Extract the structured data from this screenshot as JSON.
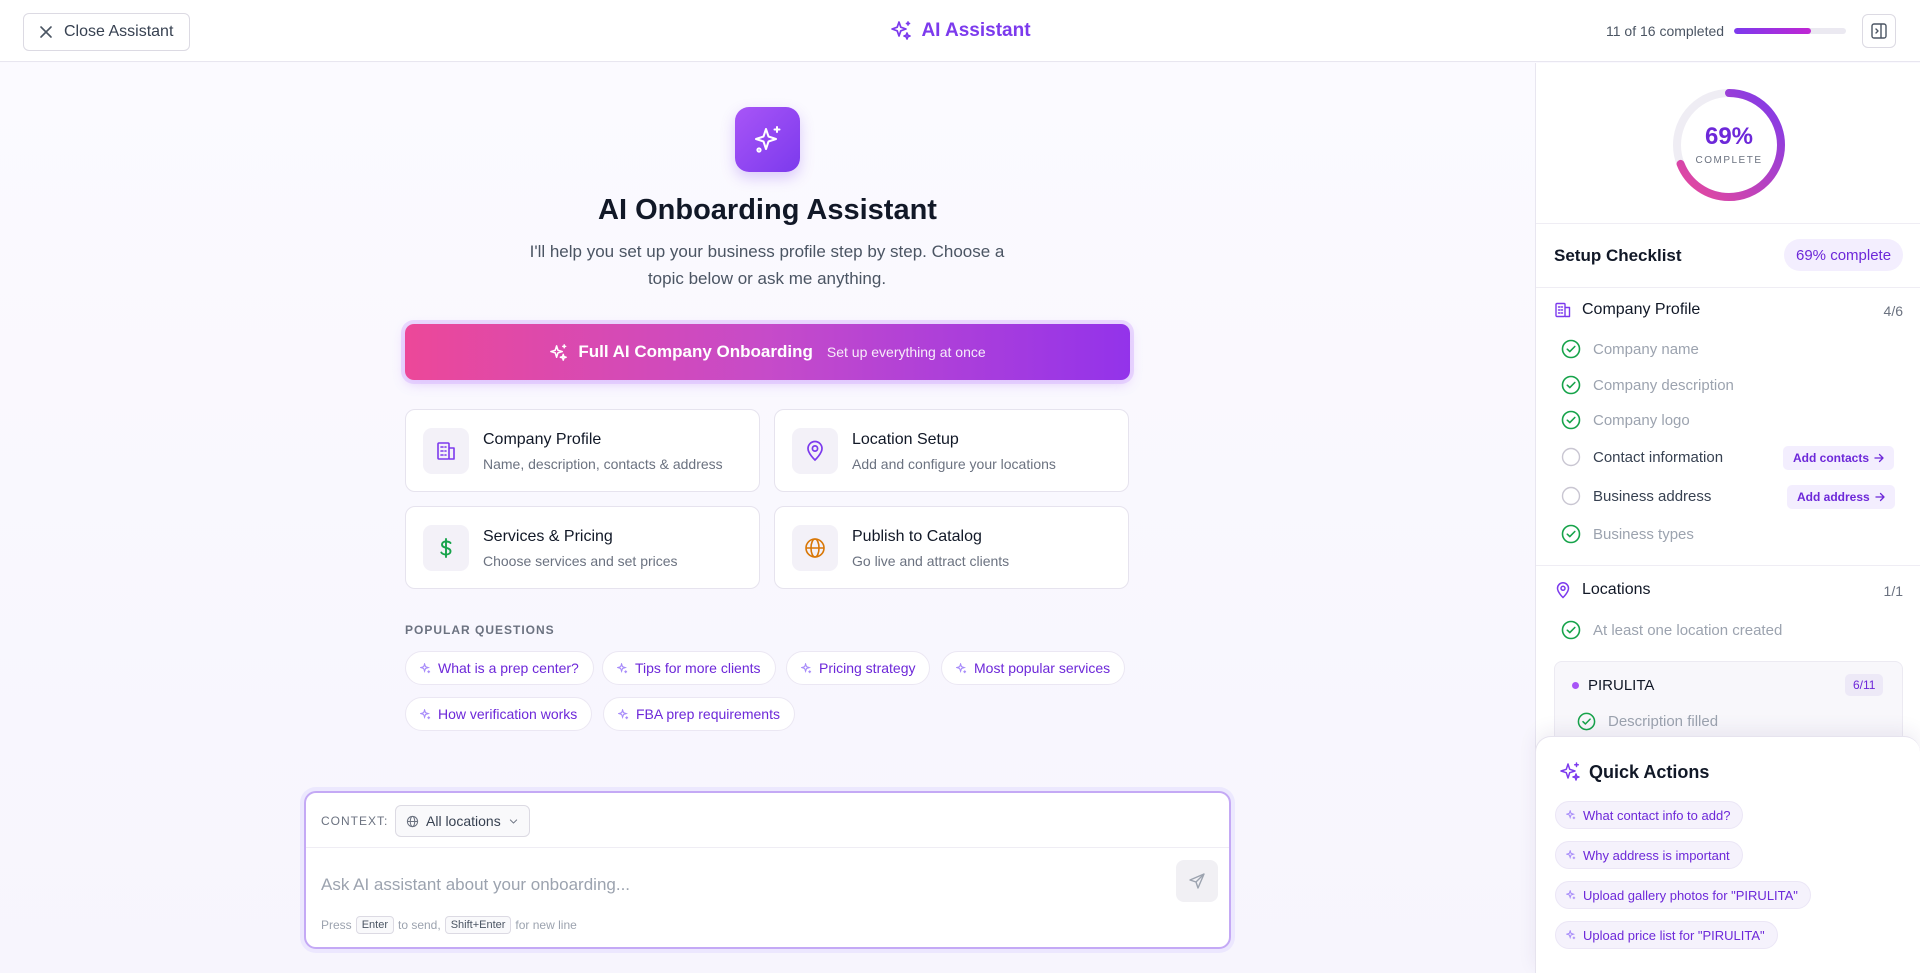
{
  "header": {
    "close_label": "Close Assistant",
    "title": "AI Assistant",
    "progress_text": "11 of 16 completed",
    "progress_fraction": 0.69
  },
  "hero": {
    "title": "AI Onboarding Assistant",
    "subtitle": "I'll help you set up your business profile step by step. Choose a topic below or ask me anything."
  },
  "full_onboarding": {
    "title": "Full AI Company Onboarding",
    "subtitle": "Set up everything at once"
  },
  "topics": [
    {
      "title": "Company Profile",
      "desc": "Name, description, contacts & address",
      "icon": "building-icon"
    },
    {
      "title": "Location Setup",
      "desc": "Add and configure your locations",
      "icon": "map-pin-icon"
    },
    {
      "title": "Services & Pricing",
      "desc": "Choose services and set prices",
      "icon": "dollar-icon"
    },
    {
      "title": "Publish to Catalog",
      "desc": "Go live and attract clients",
      "icon": "globe-icon"
    }
  ],
  "popular": {
    "label": "POPULAR QUESTIONS",
    "questions": [
      "What is a prep center?",
      "Tips for more clients",
      "Pricing strategy",
      "Most popular services",
      "How verification works",
      "FBA prep requirements"
    ]
  },
  "chat": {
    "context_label": "CONTEXT:",
    "context_value": "All locations",
    "placeholder": "Ask AI assistant about your onboarding...",
    "hint_press": "Press",
    "hint_enter": "Enter",
    "hint_to_send": "to send,",
    "hint_shift": "Shift+Enter",
    "hint_new_line": "for new line"
  },
  "sidebar": {
    "ring_percent": "69%",
    "ring_label": "COMPLETE",
    "ring_fraction": 0.69,
    "checklist_title": "Setup Checklist",
    "checklist_badge": "69% complete",
    "company": {
      "title": "Company Profile",
      "count": "4/6",
      "items": [
        {
          "label": "Company name",
          "done": true
        },
        {
          "label": "Company description",
          "done": true
        },
        {
          "label": "Company logo",
          "done": true
        },
        {
          "label": "Contact information",
          "done": false,
          "action": "Add contacts"
        },
        {
          "label": "Business address",
          "done": false,
          "action": "Add address"
        },
        {
          "label": "Business types",
          "done": true
        }
      ]
    },
    "locations": {
      "title": "Locations",
      "count": "1/1",
      "items": [
        {
          "label": "At least one location created",
          "done": true
        }
      ],
      "location_name": "PIRULITA",
      "location_count": "6/11",
      "location_item": "Description filled"
    },
    "quick_actions": {
      "title": "Quick Actions",
      "items": [
        "What contact info to add?",
        "Why address is important",
        "Upload gallery photos for \"PIRULITA\"",
        "Upload price list for \"PIRULITA\""
      ]
    }
  },
  "colors": {
    "accent": "#7c3aed",
    "pink": "#ec4899",
    "success": "#16a34a"
  }
}
